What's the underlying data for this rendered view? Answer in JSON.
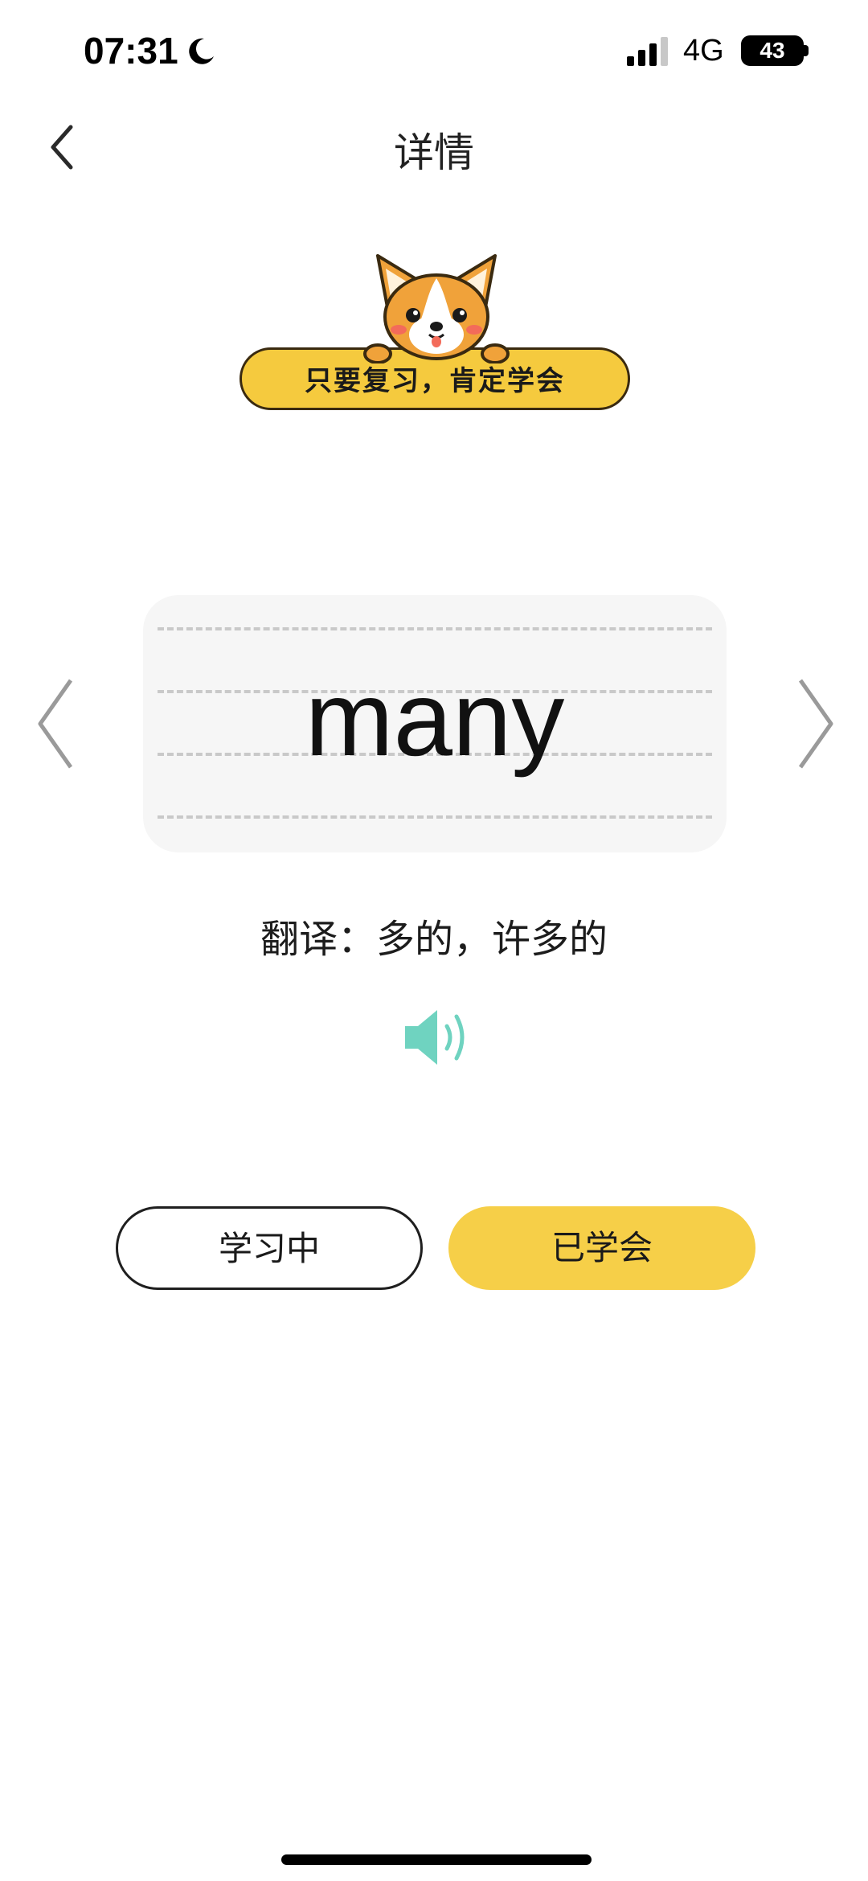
{
  "status_bar": {
    "time": "07:31",
    "network": "4G",
    "battery": "43"
  },
  "header": {
    "title": "详情",
    "back_icon": "chevron-left-icon"
  },
  "banner": {
    "text": "只要复习，肯定学会",
    "mascot": "corgi-dog-mascot"
  },
  "card": {
    "word": "many",
    "prev_icon": "chevron-left-icon",
    "next_icon": "chevron-right-icon"
  },
  "translation": "翻译：多的，许多的",
  "audio": {
    "icon": "speaker-icon",
    "color": "#6fd3c0"
  },
  "actions": {
    "learning_label": "学习中",
    "learned_label": "已学会",
    "accent": "#f6cf48"
  }
}
